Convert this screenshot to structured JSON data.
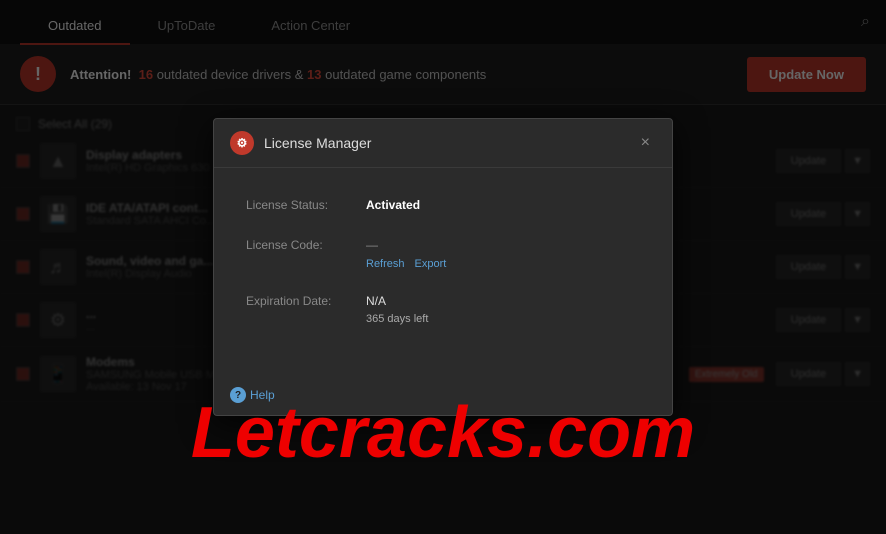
{
  "nav": {
    "tabs": [
      {
        "label": "Outdated",
        "active": true
      },
      {
        "label": "UpToDate",
        "active": false
      },
      {
        "label": "Action Center",
        "active": false
      }
    ]
  },
  "attention": {
    "title": "Attention!",
    "count_drivers": "16",
    "text_middle": " outdated device drivers & ",
    "count_components": "13",
    "text_end": " outdated game components",
    "update_button": "Update Now"
  },
  "select_all": {
    "label": "Select All (29)"
  },
  "devices": [
    {
      "name": "Display adapters",
      "sub": "Intel(R) HD Graphics 630",
      "action": "Update"
    },
    {
      "name": "IDE ATA/ATAPI cont...",
      "sub": "Standard SATA AHCI Co...",
      "action": "Update"
    },
    {
      "name": "Sound, video and ga...",
      "sub": "Intel(R) Display Audio",
      "action": "Update"
    },
    {
      "name": "...",
      "sub": "...",
      "action": "Update"
    },
    {
      "name": "Modems",
      "sub": "SAMSUNG Mobile USB Modem",
      "available": "Available: 13 Nov 17",
      "status": "Extremely Old",
      "action": "Update"
    }
  ],
  "dialog": {
    "title": "License Manager",
    "fields": {
      "license_status_label": "License Status:",
      "license_status_value": "Activated",
      "license_code_label": "License Code:",
      "license_code_value": "—",
      "refresh_link": "Refresh",
      "export_link": "Export",
      "expiration_label": "Expiration Date:",
      "expiration_value": "N/A",
      "days_left": "365 days left"
    },
    "footer": {
      "help_label": "Help"
    },
    "close_label": "×"
  },
  "watermark": {
    "text": "Letcracks.com"
  }
}
